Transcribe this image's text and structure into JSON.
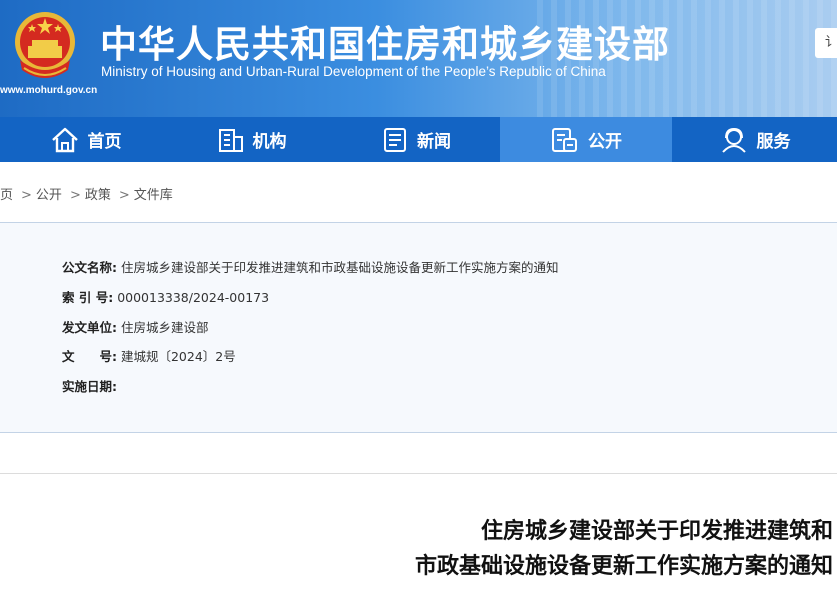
{
  "header": {
    "title_cn": "中华人民共和国住房和城乡建设部",
    "title_en": "Ministry of Housing and Urban-Rural Development of the People’s Republic of China",
    "site_url": "www.mohurd.gov.cn",
    "search_partial": "讠",
    "emblem_icon": "national-emblem-icon"
  },
  "nav": {
    "items": [
      {
        "label": "首页",
        "icon": "home-icon"
      },
      {
        "label": "机构",
        "icon": "building-icon"
      },
      {
        "label": "新闻",
        "icon": "news-icon"
      },
      {
        "label": "公开",
        "icon": "disclosure-icon"
      },
      {
        "label": "服务",
        "icon": "service-icon"
      }
    ],
    "active_index": 3,
    "colors": {
      "bar": "#1364c4",
      "active": "#3d8be0"
    }
  },
  "breadcrumb": [
    "页",
    "公开",
    "政策",
    "文件库"
  ],
  "breadcrumb_sep": ">",
  "info": {
    "title_label": "公文名称:",
    "title_value": "住房城乡建设部关于印发推进建筑和市政基础设施设备更新工作实施方案的通知",
    "index_label": "索 引 号:",
    "index_value": "000013338/2024-00173",
    "issuer_label": "发文单位:",
    "issuer_value": "住房城乡建设部",
    "docno_label": "文　　号:",
    "docno_value": "建城规〔2024〕2号",
    "date_label": "实施日期:",
    "date_value": ""
  },
  "document": {
    "title_line1": "住房城乡建设部关于印发推进建筑和",
    "title_line2": "市政基础设施设备更新工作实施方案的通知"
  }
}
